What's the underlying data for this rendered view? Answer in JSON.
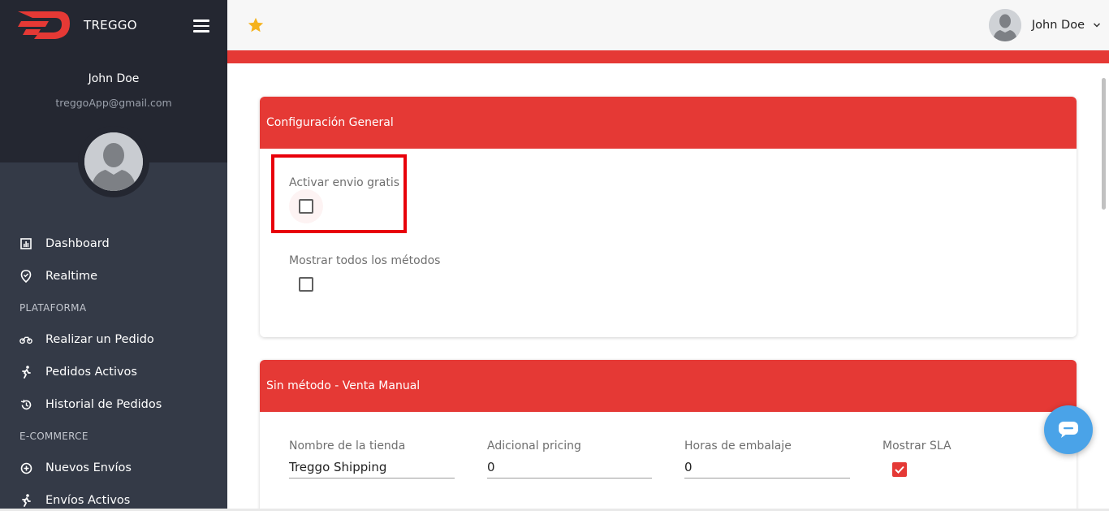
{
  "brand": {
    "name": "TREGGO"
  },
  "sidebar": {
    "user_name": "John Doe",
    "user_email": "treggoApp@gmail.com",
    "items": [
      {
        "label": "Dashboard",
        "icon": "chart-icon",
        "type": "item"
      },
      {
        "label": "Realtime",
        "icon": "map-pin-icon",
        "type": "item"
      },
      {
        "label": "PLATAFORMA",
        "type": "section"
      },
      {
        "label": "Realizar un Pedido",
        "icon": "motorcycle-icon",
        "type": "item"
      },
      {
        "label": "Pedidos Activos",
        "icon": "runner-icon",
        "type": "item"
      },
      {
        "label": "Historial de Pedidos",
        "icon": "history-icon",
        "type": "item"
      },
      {
        "label": "E-COMMERCE",
        "type": "section"
      },
      {
        "label": "Nuevos Envíos",
        "icon": "plus-circle-icon",
        "type": "item"
      },
      {
        "label": "Envíos Activos",
        "icon": "runner-icon",
        "type": "item"
      }
    ]
  },
  "topbar": {
    "user_name": "John Doe"
  },
  "card_general": {
    "title": "Configuración General",
    "free_shipping_label": "Activar envio gratis",
    "free_shipping_checked": false,
    "show_methods_label": "Mostrar todos los métodos",
    "show_methods_checked": false
  },
  "card_manual": {
    "title": "Sin método - Venta Manual",
    "store_name_label": "Nombre de la tienda",
    "store_name_value": "Treggo Shipping",
    "pricing_label": "Adicional pricing",
    "pricing_value": "0",
    "packing_label": "Horas de embalaje",
    "packing_value": "0",
    "sla_label": "Mostrar SLA",
    "sla_checked": true
  },
  "colors": {
    "accent": "#e53935",
    "sidebar": "#343a47",
    "sidebar_top": "#242731",
    "fab": "#4aa3e8",
    "star": "#f5b21b"
  }
}
